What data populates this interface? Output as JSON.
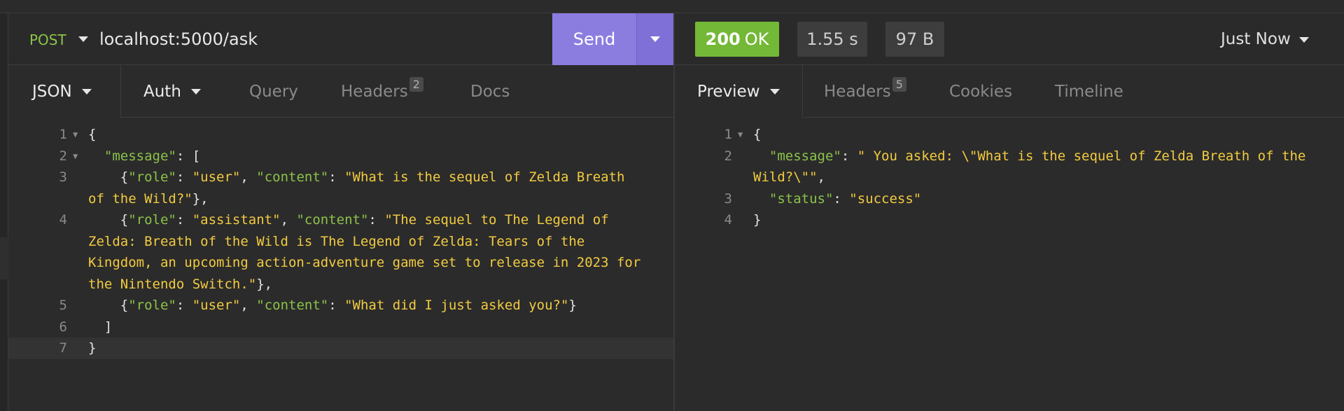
{
  "request": {
    "method": "POST",
    "url": "localhost:5000/ask",
    "send_label": "Send",
    "tabs": [
      {
        "label": "JSON"
      },
      {
        "label": "Auth"
      },
      {
        "label": "Query"
      },
      {
        "label": "Headers",
        "badge": "2"
      },
      {
        "label": "Docs"
      }
    ],
    "body_lines": [
      {
        "n": "1",
        "fold": true,
        "segs": [
          {
            "t": "{",
            "c": "p"
          }
        ]
      },
      {
        "n": "2",
        "fold": true,
        "segs": [
          {
            "t": "  ",
            "c": "p"
          },
          {
            "t": "\"message\"",
            "c": "k"
          },
          {
            "t": ": [",
            "c": "p"
          }
        ]
      },
      {
        "n": "3",
        "segs": [
          {
            "t": "    {",
            "c": "p"
          },
          {
            "t": "\"role\"",
            "c": "k"
          },
          {
            "t": ": ",
            "c": "p"
          },
          {
            "t": "\"user\"",
            "c": "s"
          },
          {
            "t": ", ",
            "c": "p"
          },
          {
            "t": "\"content\"",
            "c": "k"
          },
          {
            "t": ": ",
            "c": "p"
          },
          {
            "t": "\"What is the sequel of Zelda Breath",
            "c": "s"
          }
        ]
      },
      {
        "n": "",
        "segs": [
          {
            "t": "of the Wild?\"",
            "c": "s"
          },
          {
            "t": "},",
            "c": "p"
          }
        ]
      },
      {
        "n": "4",
        "segs": [
          {
            "t": "    {",
            "c": "p"
          },
          {
            "t": "\"role\"",
            "c": "k"
          },
          {
            "t": ": ",
            "c": "p"
          },
          {
            "t": "\"assistant\"",
            "c": "s"
          },
          {
            "t": ", ",
            "c": "p"
          },
          {
            "t": "\"content\"",
            "c": "k"
          },
          {
            "t": ": ",
            "c": "p"
          },
          {
            "t": "\"The sequel to The Legend of",
            "c": "s"
          }
        ]
      },
      {
        "n": "",
        "segs": [
          {
            "t": "Zelda: Breath of the Wild is The Legend of Zelda: Tears of the",
            "c": "s"
          }
        ]
      },
      {
        "n": "",
        "segs": [
          {
            "t": "Kingdom, an upcoming action-adventure game set to release in 2023 for",
            "c": "s"
          }
        ]
      },
      {
        "n": "",
        "segs": [
          {
            "t": "the Nintendo Switch.\"",
            "c": "s"
          },
          {
            "t": "},",
            "c": "p"
          }
        ]
      },
      {
        "n": "5",
        "segs": [
          {
            "t": "    {",
            "c": "p"
          },
          {
            "t": "\"role\"",
            "c": "k"
          },
          {
            "t": ": ",
            "c": "p"
          },
          {
            "t": "\"user\"",
            "c": "s"
          },
          {
            "t": ", ",
            "c": "p"
          },
          {
            "t": "\"content\"",
            "c": "k"
          },
          {
            "t": ": ",
            "c": "p"
          },
          {
            "t": "\"What did I just asked you?\"",
            "c": "s"
          },
          {
            "t": "}",
            "c": "p"
          }
        ]
      },
      {
        "n": "6",
        "segs": [
          {
            "t": "  ]",
            "c": "p"
          }
        ]
      },
      {
        "n": "7",
        "highlight": true,
        "segs": [
          {
            "t": "}",
            "c": "p"
          }
        ]
      }
    ]
  },
  "response": {
    "status_code": "200",
    "status_text": "OK",
    "time": "1.55 s",
    "size": "97 B",
    "timestamp": "Just Now",
    "tabs": [
      {
        "label": "Preview"
      },
      {
        "label": "Headers",
        "badge": "5"
      },
      {
        "label": "Cookies"
      },
      {
        "label": "Timeline"
      }
    ],
    "body_lines": [
      {
        "n": "1",
        "fold": true,
        "segs": [
          {
            "t": "{",
            "c": "p"
          }
        ]
      },
      {
        "n": "2",
        "segs": [
          {
            "t": "  ",
            "c": "p"
          },
          {
            "t": "\"message\"",
            "c": "k"
          },
          {
            "t": ": ",
            "c": "p"
          },
          {
            "t": "\" You asked: \\\"What is the sequel of Zelda Breath of the",
            "c": "s"
          }
        ]
      },
      {
        "n": "",
        "segs": [
          {
            "t": "Wild?\\\"\"",
            "c": "s"
          },
          {
            "t": ",",
            "c": "p"
          }
        ]
      },
      {
        "n": "3",
        "segs": [
          {
            "t": "  ",
            "c": "p"
          },
          {
            "t": "\"status\"",
            "c": "k"
          },
          {
            "t": ": ",
            "c": "p"
          },
          {
            "t": "\"success\"",
            "c": "s"
          }
        ]
      },
      {
        "n": "4",
        "segs": [
          {
            "t": "}",
            "c": "p"
          }
        ]
      }
    ]
  }
}
